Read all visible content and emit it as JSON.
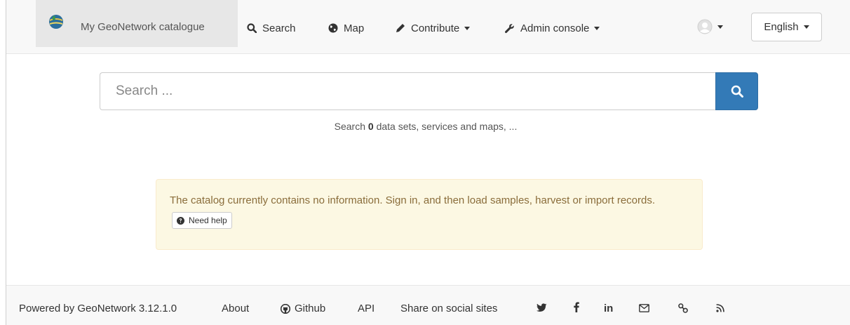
{
  "navbar": {
    "brand": "My GeoNetwork catalogue",
    "items": [
      {
        "label": "Search",
        "icon": "search-icon"
      },
      {
        "label": "Map",
        "icon": "globe-icon"
      },
      {
        "label": "Contribute",
        "icon": "pencil-icon"
      },
      {
        "label": "Admin console",
        "icon": "wrench-icon"
      }
    ],
    "user_icon": "user-avatar-icon",
    "language": "English"
  },
  "search": {
    "placeholder": "Search ...",
    "hint_prefix": "Search",
    "count": "0",
    "hint_suffix": "data sets, services and maps, ..."
  },
  "alert": {
    "message": "The catalog currently contains no information. Sign in, and then load samples, harvest or import records.",
    "help_label": "Need help"
  },
  "footer": {
    "powered": "Powered by GeoNetwork 3.12.1.0",
    "about": "About",
    "github": "Github",
    "api": "API",
    "share": "Share on social sites",
    "social_icons": [
      "twitter-icon",
      "facebook-icon",
      "linkedin-icon",
      "email-icon",
      "link-icon",
      "rss-icon"
    ]
  },
  "colors": {
    "primary": "#337ab7",
    "navbar_bg": "#f8f8f8",
    "alert_bg": "#fcf8e3",
    "alert_text": "#8a6d3b"
  }
}
